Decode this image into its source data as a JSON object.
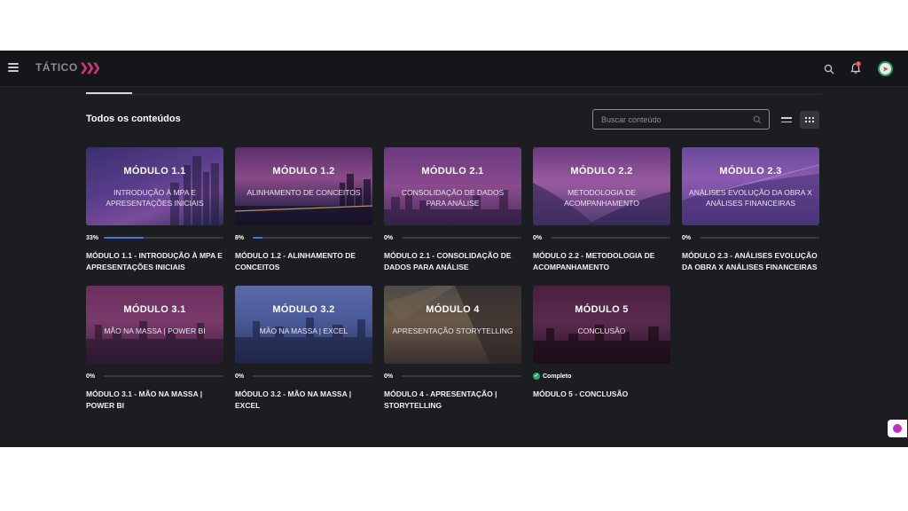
{
  "brand": {
    "logo_text": "TÁTICO",
    "logo_mark": "❯❯❯"
  },
  "header": {
    "notification_count": "1"
  },
  "content": {
    "section_title": "Todos os conteúdos",
    "search_placeholder": "Buscar conteúdo"
  },
  "colors": {
    "accent": "#4d6fe0",
    "complete": "#2fa766",
    "background": "#1b1d21"
  },
  "modules": [
    {
      "thumb_title": "MÓDULO 1.1",
      "thumb_subtitle": "INTRODUÇÃO À MPA E APRESENTAÇÕES INICIAIS",
      "progress_label": "33%",
      "progress": 0.33,
      "title": "MÓDULO 1.1 - INTRODUÇÃO À MPA E APRESENTAÇÕES INICIAIS"
    },
    {
      "thumb_title": "MÓDULO 1.2",
      "thumb_subtitle": "ALINHAMENTO DE CONCEITOS",
      "progress_label": "8%",
      "progress": 0.08,
      "title": "MÓDULO 1.2 - ALINHAMENTO DE CONCEITOS"
    },
    {
      "thumb_title": "MÓDULO 2.1",
      "thumb_subtitle": "CONSOLIDAÇÃO DE DADOS PARA ANÁLISE",
      "progress_label": "0%",
      "progress": 0,
      "title": "MÓDULO 2.1 - CONSOLIDAÇÃO DE DADOS PARA ANÁLISE"
    },
    {
      "thumb_title": "MÓDULO 2.2",
      "thumb_subtitle": "METODOLOGIA DE ACOMPANHAMENTO",
      "progress_label": "0%",
      "progress": 0,
      "title": "MÓDULO 2.2 - METODOLOGIA DE ACOMPANHAMENTO"
    },
    {
      "thumb_title": "MÓDULO 2.3",
      "thumb_subtitle": "ANÁLISES EVOLUÇÃO DA OBRA X ANÁLISES FINANCEIRAS",
      "progress_label": "0%",
      "progress": 0,
      "title": "MÓDULO 2.3 - ANÁLISES EVOLUÇÃO DA OBRA X ANÁLISES FINANCEIRAS"
    },
    {
      "thumb_title": "MÓDULO 3.1",
      "thumb_subtitle": "MÃO NA MASSA | POWER BI",
      "progress_label": "0%",
      "progress": 0,
      "title": "MÓDULO 3.1 - MÃO NA MASSA | POWER BI"
    },
    {
      "thumb_title": "MÓDULO 3.2",
      "thumb_subtitle": "MÃO NA MASSA | EXCEL",
      "progress_label": "0%",
      "progress": 0,
      "title": "MÓDULO 3.2 - MÃO NA MASSA | EXCEL"
    },
    {
      "thumb_title": "MÓDULO 4",
      "thumb_subtitle": "APRESENTAÇÃO STORYTELLING",
      "progress_label": "0%",
      "progress": 0,
      "title": "MÓDULO 4 - APRESENTAÇÃO | STORYTELLING"
    },
    {
      "thumb_title": "MÓDULO 5",
      "thumb_subtitle": "CONCLUSÃO",
      "status_label": "Completo",
      "title": "MÓDULO 5 - CONCLUSÃO"
    }
  ]
}
